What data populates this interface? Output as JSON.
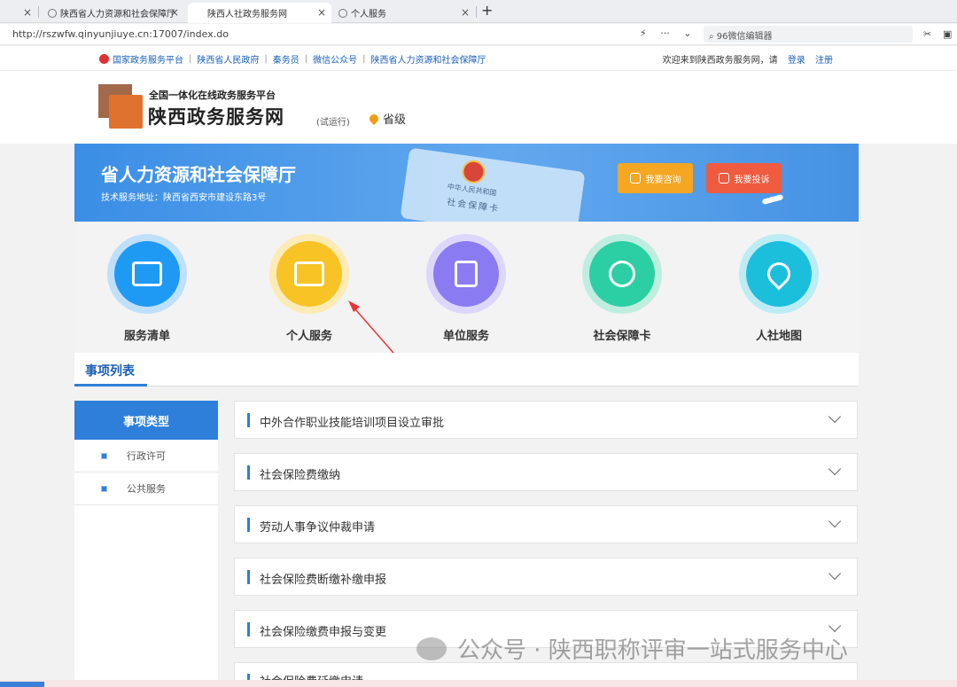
{
  "browser": {
    "tabs": [
      {
        "label": "陕西省人力资源和社会保障厅"
      },
      {
        "label": "陕西人社政务服务网"
      },
      {
        "label": "个人服务"
      }
    ],
    "address": "http://rszwfw.qinyunjiuye.cn:17007/index.do",
    "search_text": "96微信编辑器"
  },
  "topnav": {
    "links": [
      "国家政务服务平台",
      "陕西省人民政府",
      "秦务员",
      "微信公众号",
      "陕西省人力资源和社会保障厅"
    ],
    "welcome": "欢迎来到陕西政务服务网，请",
    "login": "登录",
    "register": "注册"
  },
  "header": {
    "platform": "全国一体化在线政务服务平台",
    "site_name": "陕西政务服务网",
    "trial": "(试运行)",
    "level": "省级"
  },
  "banner": {
    "title": "省人力资源和社会保障厅",
    "address": "技术服务地址：陕西省西安市建设东路3号",
    "card_line1": "中华人民共和国",
    "card_line2": "社会保障卡",
    "consult": "我要咨询",
    "complain": "我要投诉"
  },
  "services": [
    {
      "label": "服务清单",
      "color": "#1e9af5",
      "ring": "#bfe0fb",
      "icon": "presentation-icon"
    },
    {
      "label": "个人服务",
      "color": "#f7c325",
      "ring": "#fcebb4",
      "icon": "id-card-icon"
    },
    {
      "label": "单位服务",
      "color": "#8a7bf2",
      "ring": "#ddd7fb",
      "icon": "building-icon"
    },
    {
      "label": "社会保障卡",
      "color": "#2ccfa3",
      "ring": "#bfeee1",
      "icon": "people-exchange-icon"
    },
    {
      "label": "人社地图",
      "color": "#1bbfdc",
      "ring": "#bcecf4",
      "icon": "map-pin-icon"
    }
  ],
  "list": {
    "title": "事项列表",
    "left_head": "事项类型",
    "left_items": [
      "行政许可",
      "公共服务"
    ],
    "rows": [
      "中外合作职业技能培训项目设立审批",
      "社会保险费缴纳",
      "劳动人事争议仲裁申请",
      "社会保险费断缴补缴申报",
      "社会保险缴费申报与变更",
      "社会保险费延缴申请"
    ]
  },
  "watermark": "公众号 · 陕西职称评审一站式服务中心"
}
